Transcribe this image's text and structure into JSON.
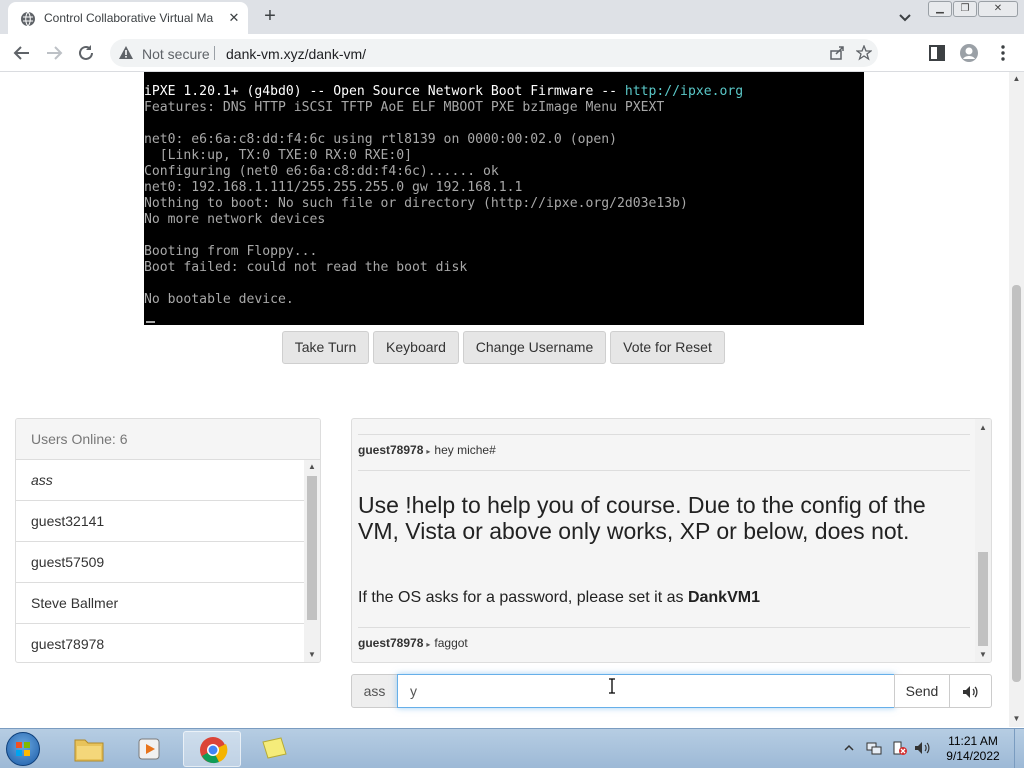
{
  "browser": {
    "tab_title": "Control Collaborative Virtual Ma",
    "not_secure": "Not secure",
    "url": "dank-vm.xyz/dank-vm/"
  },
  "vm": {
    "console_lines": [
      {
        "text": "iPXE 1.20.1+ (g4bd0) -- Open Source Network Boot Firmware -- ",
        "link": "http://ipxe.org"
      },
      {
        "text": "Features: DNS HTTP iSCSI TFTP AoE ELF MBOOT PXE bzImage Menu PXEXT"
      },
      {
        "text": ""
      },
      {
        "text": "net0: e6:6a:c8:dd:f4:6c using rtl8139 on 0000:00:02.0 (open)"
      },
      {
        "text": "  [Link:up, TX:0 TXE:0 RX:0 RXE:0]"
      },
      {
        "text": "Configuring (net0 e6:6a:c8:dd:f4:6c)...... ok"
      },
      {
        "text": "net0: 192.168.1.111/255.255.255.0 gw 192.168.1.1"
      },
      {
        "text": "Nothing to boot: No such file or directory (http://ipxe.org/2d03e13b)"
      },
      {
        "text": "No more network devices"
      },
      {
        "text": ""
      },
      {
        "text": "Booting from Floppy..."
      },
      {
        "text": "Boot failed: could not read the boot disk"
      },
      {
        "text": ""
      },
      {
        "text": "No bootable device."
      }
    ],
    "buttons": {
      "take_turn": "Take Turn",
      "keyboard": "Keyboard",
      "change_username": "Change Username",
      "vote_reset": "Vote for Reset"
    }
  },
  "users": {
    "header": "Users Online: 6",
    "list": [
      "ass",
      "guest32141",
      "guest57509",
      "Steve Ballmer",
      "guest78978"
    ]
  },
  "chat": {
    "messages": [
      {
        "user": "guest78978",
        "text": "hey miche#"
      },
      {
        "user": "guest78978",
        "text": "faggot"
      }
    ],
    "motd": "Use !help to help you of course. Due to the config of the VM, Vista or above only works, XP or below, does not.",
    "password_text": "If the OS asks for a password, please set it as ",
    "password": "DankVM1",
    "username": "ass",
    "input_value": "y",
    "send_label": "Send"
  },
  "taskbar": {
    "time": "11:21 AM",
    "date": "9/14/2022"
  },
  "colors": {
    "console_fg": "#a8a8a8",
    "console_link": "#5ac8c8",
    "input_focus": "#66afe9"
  }
}
